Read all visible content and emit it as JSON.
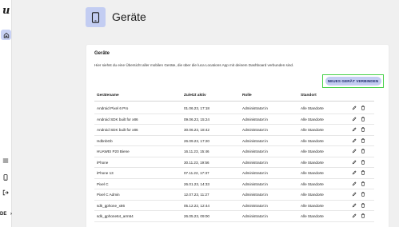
{
  "sidebar": {
    "logo": "u",
    "language": "DE",
    "language_chevron": "›",
    "icons": [
      "home-icon",
      "menu-icon",
      "device-icon",
      "logout-icon"
    ]
  },
  "header": {
    "title": "Geräte",
    "icon": "smartphone-icon"
  },
  "card": {
    "title": "Geräte",
    "description": "Hier siehst du eine Übersicht aller mobilen Geräte, die über die luca Locations App mit deinem Dashboard verbunden sind.",
    "new_device_label": "NEUES GERÄT VERBINDEN"
  },
  "table": {
    "headers": [
      "Gerätename",
      "Zuletzt aktiv",
      "Rolle",
      "Standort"
    ],
    "rows": [
      {
        "name": "Android Pixel 6 Pro",
        "last_active": "01.06.23, 17:18",
        "role": "Administrator:in",
        "location": "Alle Standorte"
      },
      {
        "name": "Android SDK built for x86",
        "last_active": "09.06.23, 15:24",
        "role": "Administrator:in",
        "location": "Alle Standorte"
      },
      {
        "name": "Android SDK built for x86",
        "last_active": "30.06.23, 18:42",
        "role": "Administrator:in",
        "location": "Alle Standorte"
      },
      {
        "name": "HdbnbGb",
        "last_active": "26.09.23, 17:20",
        "role": "Administrator:in",
        "location": "Alle Standorte"
      },
      {
        "name": "HUAWEI P20 Biene",
        "last_active": "16.11.23, 15:46",
        "role": "Administrator:in",
        "location": "Alle Standorte"
      },
      {
        "name": "iPhone",
        "last_active": "30.11.23, 19:56",
        "role": "Administrator:in",
        "location": "Alle Standorte"
      },
      {
        "name": "iPhone 13",
        "last_active": "07.11.22, 17:37",
        "role": "Administrator:in",
        "location": "Alle Standorte"
      },
      {
        "name": "Pixel C",
        "last_active": "26.01.23, 14:33",
        "role": "Administrator:in",
        "location": "Alle Standorte"
      },
      {
        "name": "Pixel C Admin",
        "last_active": "12.07.23, 11:27",
        "role": "Administrator:in",
        "location": "Alle Standorte"
      },
      {
        "name": "sdk_gphone_x86",
        "last_active": "05.12.22, 12:44",
        "role": "Administrator:in",
        "location": "Alle Standorte"
      },
      {
        "name": "sdk_gphone64_arm64",
        "last_active": "26.05.23, 09:00",
        "role": "Administrator:in",
        "location": "Alle Standorte"
      }
    ],
    "row_actions": [
      "edit-icon",
      "delete-icon"
    ]
  },
  "colors": {
    "accent_light": "#c3cdf2",
    "highlight_border": "#47d14a",
    "button_text": "#1d2a6b"
  }
}
